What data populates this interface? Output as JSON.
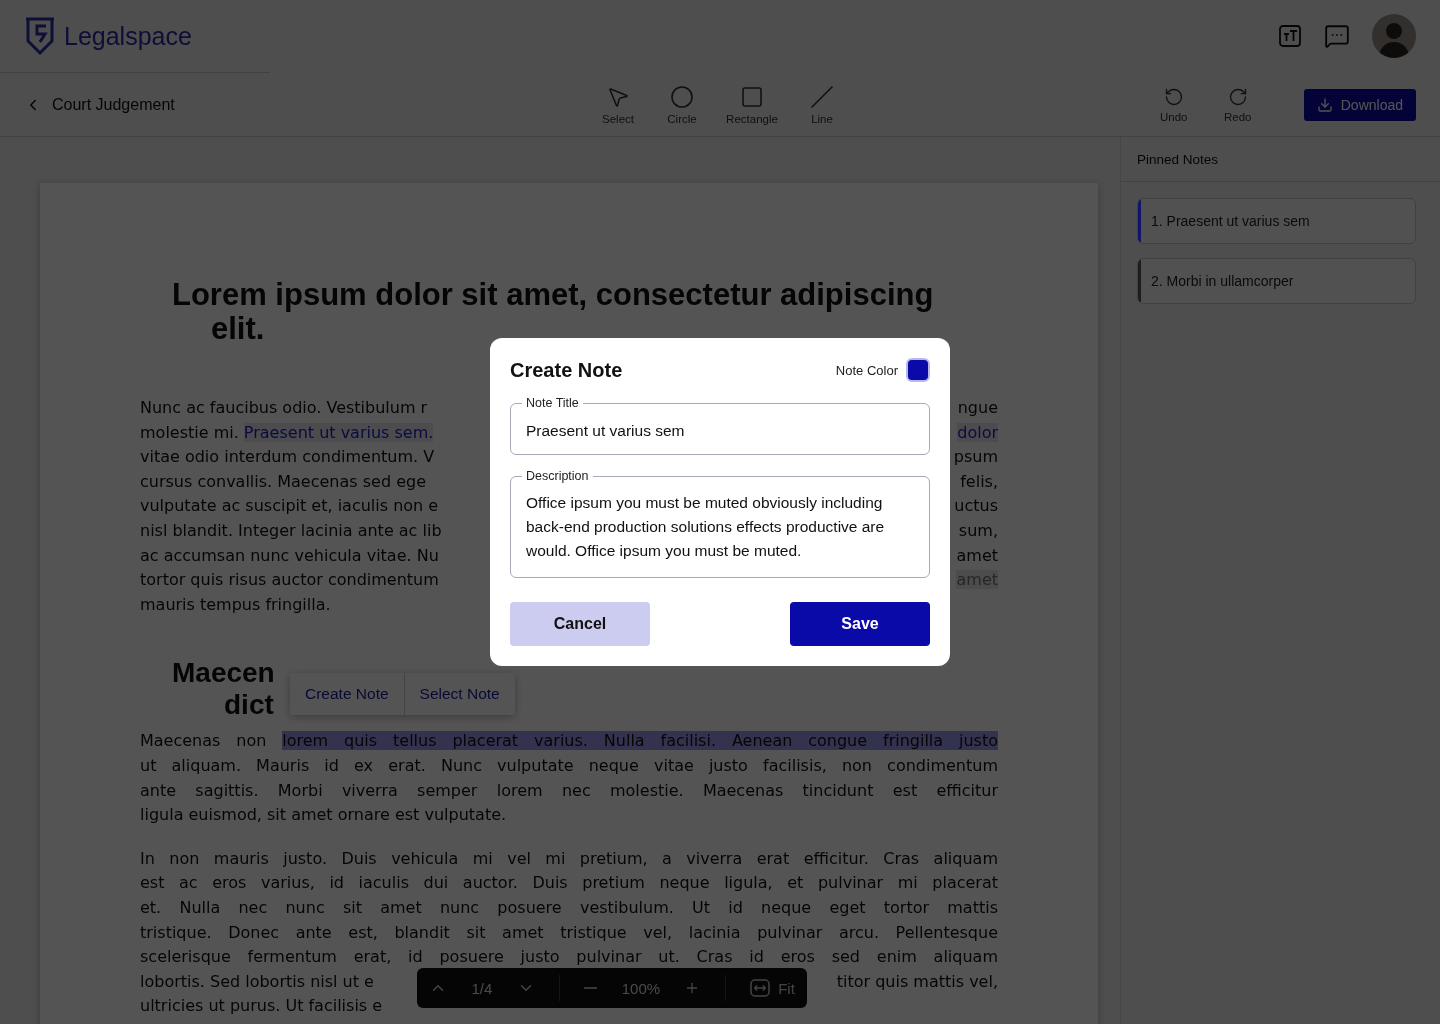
{
  "brand": "Legalspace",
  "back_label": "Court Judgement",
  "tools": [
    {
      "kind": "select",
      "label": "Select"
    },
    {
      "kind": "circle",
      "label": "Circle"
    },
    {
      "kind": "rectangle",
      "label": "Rectangle"
    },
    {
      "kind": "line",
      "label": "Line"
    }
  ],
  "history": [
    {
      "kind": "undo",
      "label": "Undo"
    },
    {
      "kind": "redo",
      "label": "Redo"
    }
  ],
  "download_label": "Download",
  "document": {
    "blocks": [
      {
        "kind": "heading",
        "lines": [
          {
            "left": [
              {
                "kind": "plain",
                "text": "Lorem ipsum dolor sit amet, consectetur adipiscing"
              }
            ]
          },
          {
            "left": [
              {
                "kind": "plain",
                "text": "elit."
              }
            ]
          }
        ]
      },
      {
        "kind": "paragraph",
        "lines": [
          {
            "left": [
              {
                "kind": "plain",
                "text": "Nunc ac faucibus odio. Vestibulum r"
              }
            ],
            "right": [
              {
                "kind": "plain",
                "text": "ngue"
              }
            ]
          },
          {
            "left": [
              {
                "kind": "plain",
                "text": "molestie mi. "
              },
              {
                "kind": "note",
                "text": "Praesent ut varius sem."
              }
            ],
            "right": [
              {
                "kind": "note",
                "text": "dolor"
              }
            ]
          },
          {
            "left": [
              {
                "kind": "plain",
                "text": "vitae odio interdum condimentum. V"
              }
            ],
            "right": [
              {
                "kind": "plain",
                "text": "psum"
              }
            ]
          },
          {
            "left": [
              {
                "kind": "plain",
                "text": "cursus convallis. Maecenas sed ege"
              }
            ],
            "right": [
              {
                "kind": "plain",
                "text": "felis,"
              }
            ]
          },
          {
            "left": [
              {
                "kind": "plain",
                "text": "vulputate ac suscipit et, iaculis non e"
              }
            ],
            "right": [
              {
                "kind": "plain",
                "text": "uctus"
              }
            ]
          },
          {
            "left": [
              {
                "kind": "plain",
                "text": "nisl blandit. Integer lacinia ante ac lib"
              }
            ],
            "right": [
              {
                "kind": "plain",
                "text": "sum,"
              }
            ]
          },
          {
            "left": [
              {
                "kind": "plain",
                "text": "ac accumsan nunc vehicula vitae. Nu"
              }
            ],
            "right": [
              {
                "kind": "plain",
                "text": "amet"
              }
            ]
          },
          {
            "left": [
              {
                "kind": "plain",
                "text": "tortor quis risus auctor condimentum"
              }
            ],
            "right": [
              {
                "kind": "muted",
                "text": "amet"
              }
            ]
          },
          {
            "left": [
              {
                "kind": "plain",
                "text": "mauris tempus fringilla."
              }
            ]
          }
        ]
      },
      {
        "kind": "heading",
        "lines": [
          {
            "left": [
              {
                "kind": "plain",
                "text": "Maecen"
              }
            ]
          },
          {
            "left": [
              {
                "kind": "plain",
                "text": "dict"
              }
            ]
          }
        ]
      },
      {
        "kind": "paragraph",
        "lines": [
          {
            "left": [
              {
                "kind": "plain",
                "text": "Maecenas non "
              },
              {
                "kind": "selection",
                "text": "lorem quis tellus placerat varius. Nulla facilisi. Aenean congue fringilla justo"
              }
            ]
          },
          {
            "left": [
              {
                "kind": "plain",
                "text": "ut aliquam. Mauris id ex erat. Nunc vulputate neque vitae justo facilisis, non condimentum"
              }
            ]
          },
          {
            "left": [
              {
                "kind": "plain",
                "text": "ante sagittis. Morbi viverra semper lorem nec molestie. Maecenas tincidunt est efficitur"
              }
            ]
          },
          {
            "left": [
              {
                "kind": "plain",
                "text": "ligula euismod, sit amet ornare est vulputate."
              }
            ]
          }
        ]
      },
      {
        "kind": "paragraph",
        "lines": [
          {
            "left": [
              {
                "kind": "plain",
                "text": "In non mauris justo. Duis vehicula mi vel mi pretium, a viverra erat efficitur. Cras aliquam"
              }
            ]
          },
          {
            "left": [
              {
                "kind": "plain",
                "text": "est ac eros varius, id iaculis dui auctor. Duis pretium neque ligula, et pulvinar mi placerat"
              }
            ]
          },
          {
            "left": [
              {
                "kind": "plain",
                "text": "et. Nulla nec nunc sit amet nunc posuere vestibulum. Ut id neque eget tortor mattis"
              }
            ]
          },
          {
            "left": [
              {
                "kind": "plain",
                "text": "tristique. Donec ante est, blandit sit amet tristique vel, lacinia pulvinar arcu. Pellentesque"
              }
            ]
          },
          {
            "left": [
              {
                "kind": "plain",
                "text": "scelerisque fermentum erat, id posuere justo pulvinar ut. Cras id eros sed enim aliquam"
              }
            ]
          },
          {
            "left": [
              {
                "kind": "plain",
                "text": "lobortis. Sed lobortis nisl ut e"
              }
            ],
            "right": [
              {
                "kind": "plain",
                "text": "titor quis mattis vel,"
              }
            ]
          },
          {
            "left": [
              {
                "kind": "plain",
                "text": "ultricies ut purus. Ut facilisis e"
              }
            ]
          }
        ]
      }
    ]
  },
  "selection_menu": [
    "Create Note",
    "Select Note"
  ],
  "pager": {
    "page": "1/4",
    "zoom": "100%",
    "fit_label": "Fit"
  },
  "pinned_notes": {
    "title": "Pinned Notes",
    "items": [
      {
        "label": "1. Praesent ut varius sem",
        "color": "#14146e"
      },
      {
        "label": "2. Morbi in ullamcorper",
        "color": "#1e1e1e"
      }
    ]
  },
  "modal": {
    "title": "Create Note",
    "color_label": "Note Color",
    "color": "#0a0aa8",
    "fields": [
      {
        "kind": "input",
        "label": "Note Title",
        "value": "Praesent ut varius sem"
      },
      {
        "kind": "textarea",
        "label": "Description",
        "value": "Office ipsum you must be muted obviously including back-end production solutions effects productive are would. Office ipsum you must be muted."
      }
    ],
    "cancel": "Cancel",
    "save": "Save"
  }
}
